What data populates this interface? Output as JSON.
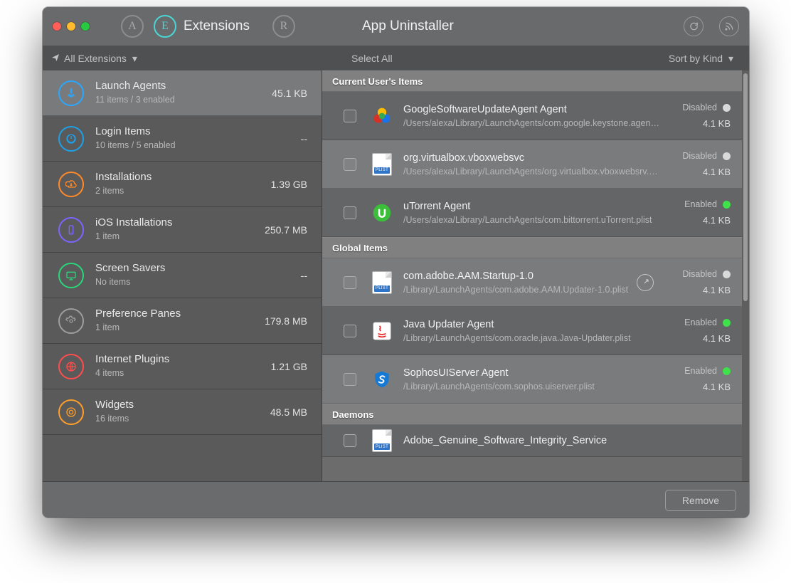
{
  "header": {
    "tab_a_letter": "A",
    "tab_e_letter": "E",
    "tab_e_label": "Extensions",
    "tab_r_letter": "R",
    "app_title": "App Uninstaller"
  },
  "subbar": {
    "filter_label": "All Extensions",
    "select_all": "Select All",
    "sort_label": "Sort by Kind"
  },
  "sidebar": [
    {
      "key": "launch-agents",
      "title": "Launch Agents",
      "subtitle": "11 items / 3 enabled",
      "size": "45.1 KB",
      "color": "#2aa7ff",
      "selected": true
    },
    {
      "key": "login-items",
      "title": "Login Items",
      "subtitle": "10 items / 5 enabled",
      "size": "--",
      "color": "#1fa0e6"
    },
    {
      "key": "installations",
      "title": "Installations",
      "subtitle": "2 items",
      "size": "1.39 GB",
      "color": "#ff8a2a"
    },
    {
      "key": "ios-installations",
      "title": "iOS Installations",
      "subtitle": "1 item",
      "size": "250.7 MB",
      "color": "#7a66ff"
    },
    {
      "key": "screen-savers",
      "title": "Screen Savers",
      "subtitle": "No items",
      "size": "--",
      "color": "#29d67a"
    },
    {
      "key": "preference-panes",
      "title": "Preference Panes",
      "subtitle": "1 item",
      "size": "179.8 MB",
      "color": "#9e9e9e"
    },
    {
      "key": "internet-plugins",
      "title": "Internet Plugins",
      "subtitle": "4 items",
      "size": "1.21 GB",
      "color": "#ff4d4d"
    },
    {
      "key": "widgets",
      "title": "Widgets",
      "subtitle": "16 items",
      "size": "48.5 MB",
      "color": "#ff9e2b"
    }
  ],
  "sections": [
    {
      "title": "Current User's Items",
      "items": [
        {
          "name": "GoogleSoftwareUpdateAgent Agent",
          "path": "/Users/alexa/Library/LaunchAgents/com.google.keystone.agent.plist",
          "status": "Disabled",
          "size": "4.1 KB",
          "icon": "google"
        },
        {
          "name": "org.virtualbox.vboxwebsvc",
          "path": "/Users/alexa/Library/LaunchAgents/org.virtualbox.vboxwebsrv.plist",
          "status": "Disabled",
          "size": "4.1 KB",
          "icon": "plist"
        },
        {
          "name": "uTorrent Agent",
          "path": "/Users/alexa/Library/LaunchAgents/com.bittorrent.uTorrent.plist",
          "status": "Enabled",
          "size": "4.1 KB",
          "icon": "utorrent"
        }
      ]
    },
    {
      "title": "Global Items",
      "items": [
        {
          "name": "com.adobe.AAM.Startup-1.0",
          "path": "/Library/LaunchAgents/com.adobe.AAM.Updater-1.0.plist",
          "status": "Disabled",
          "size": "4.1 KB",
          "icon": "plist",
          "reveal": true
        },
        {
          "name": "Java Updater Agent",
          "path": "/Library/LaunchAgents/com.oracle.java.Java-Updater.plist",
          "status": "Enabled",
          "size": "4.1 KB",
          "icon": "java"
        },
        {
          "name": "SophosUIServer Agent",
          "path": "/Library/LaunchAgents/com.sophos.uiserver.plist",
          "status": "Enabled",
          "size": "4.1 KB",
          "icon": "sophos"
        }
      ]
    },
    {
      "title": "Daemons",
      "items": [
        {
          "name": "Adobe_Genuine_Software_Integrity_Service",
          "path": "",
          "status": "",
          "size": "",
          "icon": "plist",
          "partial": true
        }
      ]
    }
  ],
  "footer": {
    "remove_label": "Remove"
  }
}
